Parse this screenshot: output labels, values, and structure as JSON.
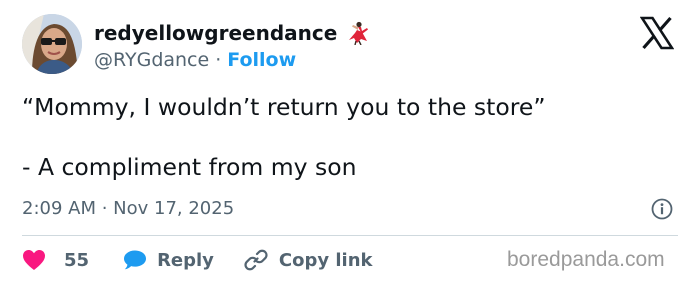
{
  "author": {
    "display_name": "redyellowgreendance",
    "handle": "@RYGdance",
    "separator": "·",
    "follow_label": "Follow",
    "name_emoji_icon": "dancer-icon"
  },
  "tweet": {
    "line1": "“Mommy, I wouldn’t return you to the store”",
    "line2": "- A compliment from my son"
  },
  "meta": {
    "timestamp": "2:09 AM · Nov 17, 2025",
    "info_icon": "info-icon"
  },
  "actions": {
    "like_count": "55",
    "reply_label": "Reply",
    "copy_label": "Copy link"
  },
  "brand": {
    "logo_icon": "x-logo-icon",
    "watermark": "boredpanda.com"
  },
  "colors": {
    "text": "#0f1419",
    "secondary": "#536471",
    "accent": "#1d9bf0",
    "like": "#f91880",
    "divider": "#cfd9de"
  }
}
